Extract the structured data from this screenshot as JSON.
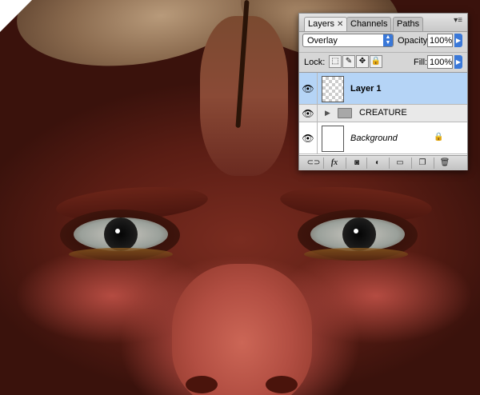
{
  "panel": {
    "tabs": [
      {
        "label": "Layers",
        "close": "✕",
        "active": true
      },
      {
        "label": "Channels",
        "active": false
      },
      {
        "label": "Paths",
        "active": false
      }
    ],
    "blend_mode": "Overlay",
    "opacity_label": "Opacity:",
    "opacity_value": "100%",
    "lock_label": "Lock:",
    "fill_label": "Fill:",
    "fill_value": "100%"
  },
  "layers": [
    {
      "name": "Layer 1",
      "visible": true,
      "selected": true,
      "type": "layer"
    },
    {
      "name": "CREATURE",
      "visible": true,
      "selected": false,
      "type": "group",
      "expanded": false
    },
    {
      "name": "Background",
      "visible": true,
      "selected": false,
      "type": "background",
      "locked": true
    }
  ],
  "bottom_bar": {
    "fx_label": "fx"
  },
  "colors": {
    "selection": "#b5d4f6",
    "accent": "#3a78d8"
  }
}
